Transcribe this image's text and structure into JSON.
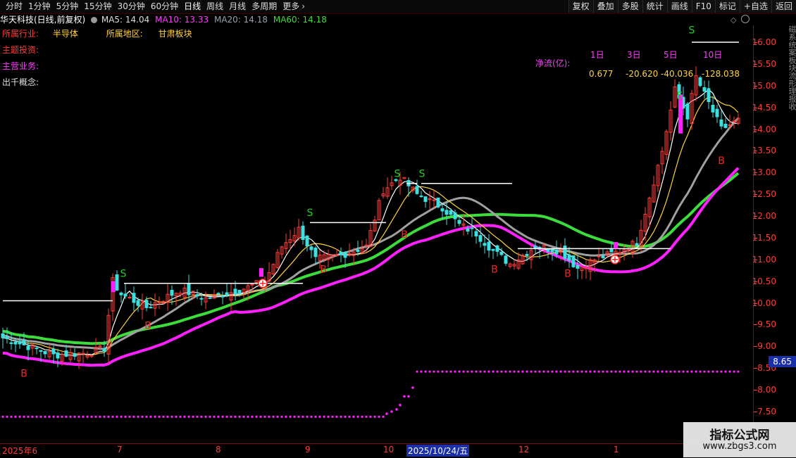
{
  "toolbar": {
    "periods": [
      "分时",
      "1分钟",
      "5分钟",
      "15分钟",
      "30分钟",
      "60分钟",
      "日线",
      "周线",
      "月线",
      "多周期",
      "更多"
    ],
    "active_period": "日线",
    "more_arrow": "chevron-right-icon",
    "right_buttons": [
      "复权",
      "叠加",
      "多股",
      "统计",
      "画线",
      "F10",
      "标记",
      "+自选",
      "返回"
    ]
  },
  "stock": {
    "title": "华天科技(日线,前复权)",
    "ma5": "MA5: 14.04",
    "ma10": "MA10: 13.33",
    "ma20": "MA20: 14.18",
    "ma60": "MA60: 14.18"
  },
  "info": {
    "industry_label": "所属行业:",
    "industry_value": "半导体",
    "region_label": "所属地区:",
    "region_value": "甘肃板块",
    "theme_label": "主题投资:",
    "business_label": "主营业务:",
    "concept_label": "出千概念:"
  },
  "net_flow": {
    "label": "净流(亿):",
    "headers": [
      "1日",
      "3日",
      "5日",
      "10日"
    ],
    "values": [
      "0.677",
      "-20.620",
      "-40.036",
      "-128.038"
    ]
  },
  "axis_ticks": [
    "16.00",
    "15.50",
    "15.00",
    "14.50",
    "14.00",
    "13.50",
    "13.00",
    "12.50",
    "12.00",
    "11.50",
    "11.00",
    "10.50",
    "10.00",
    "9.50",
    "9.00",
    "8.50",
    "8.00",
    "7.50"
  ],
  "current_price": "8.65",
  "dates": [
    "2025年6",
    "7",
    "8",
    "9",
    "10",
    "2025/10/24/五",
    "12",
    "1"
  ],
  "watermark": {
    "line1": "指标公式网",
    "line2": "www.zbgs3.com"
  },
  "side_strip_text": "磁系统案板块流形理报收",
  "chart_data": {
    "type": "candlestick",
    "ylim": [
      7.1,
      16.4
    ],
    "markers": [
      {
        "label": "B",
        "color": "#ff2020"
      },
      {
        "label": "S",
        "color": "#20d020"
      }
    ],
    "signal_labels": {
      "s": "S",
      "b": "B"
    },
    "colors": {
      "up": "#ff3c3c",
      "down": "#3ce0e0",
      "ma5": "#ffffff",
      "ma10": "#ffd23c",
      "ma20": "#a0a0a0",
      "ma60": "#3cdc3c",
      "base": "#ff20ff"
    }
  }
}
